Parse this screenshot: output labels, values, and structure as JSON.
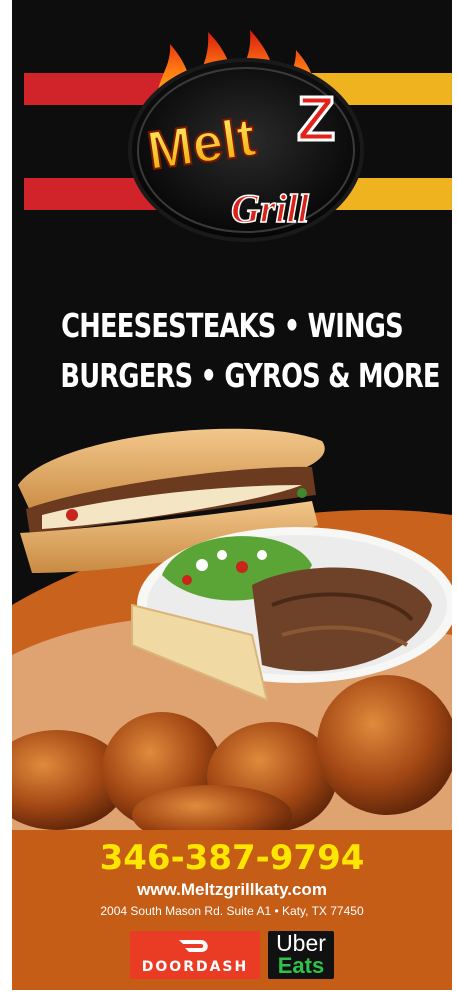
{
  "brand": {
    "name_main": "Melt",
    "name_accent": "Z",
    "name_sub": "Grill",
    "colors": {
      "red": "#d0242a",
      "yellow": "#f0b320",
      "background": "#0d0d0d",
      "footer": "#c65d17",
      "phone": "#ffe600"
    }
  },
  "tagline": {
    "line1": "CHEESESTEAKS • WINGS",
    "line2": "BURGERS • GYROS & MORE"
  },
  "food_photo": {
    "items": [
      "cheesesteak-sandwich",
      "gyro-platter",
      "chicken-wings"
    ]
  },
  "contact": {
    "phone": "346-387-9794",
    "website": "www.Meltzgrillkaty.com",
    "address": "2004 South Mason Rd. Suite A1 • Katy, TX 77450"
  },
  "delivery": {
    "doordash_label": "DOORDASH",
    "uber_label": "Uber",
    "eats_label": "Eats"
  }
}
